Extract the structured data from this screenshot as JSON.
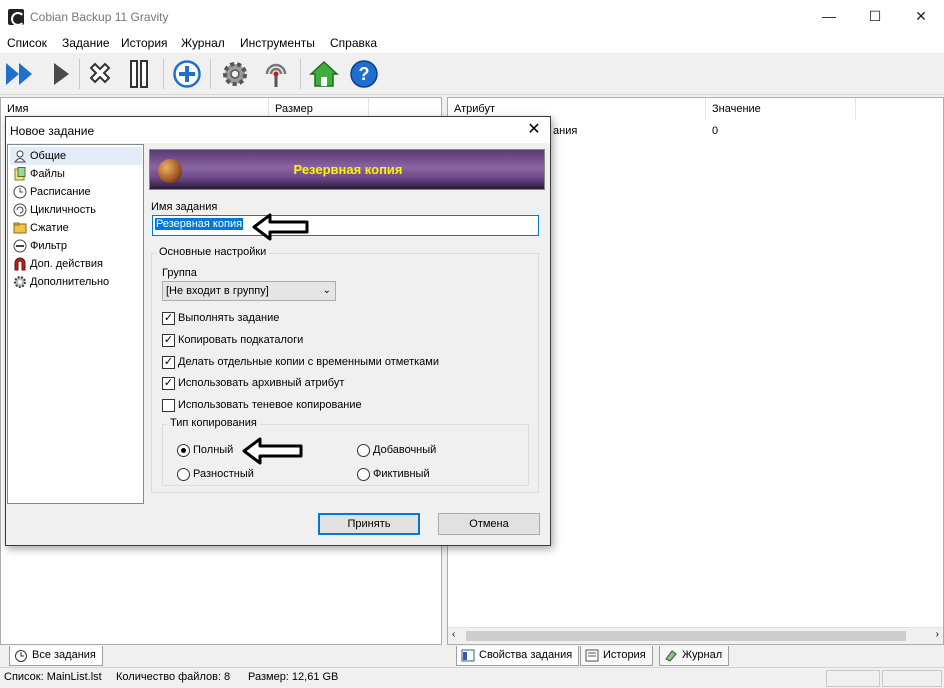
{
  "window": {
    "title": "Cobian Backup 11 Gravity",
    "minimize": "—",
    "maximize": "☐",
    "close": "✕"
  },
  "menu": [
    "Список",
    "Задание",
    "История",
    "Журнал",
    "Инструменты",
    "Справка"
  ],
  "toolbar": {
    "icons": [
      "run-all-icon",
      "run-icon",
      "cancel-icon",
      "pause-icon",
      "add-task-icon",
      "settings-icon",
      "signal-icon",
      "home-icon",
      "help-icon"
    ]
  },
  "left_pane": {
    "columns": [
      "Имя",
      "Размер"
    ]
  },
  "right_pane": {
    "columns": [
      "Атрибут",
      "Значение"
    ],
    "row_attribute_partial": "ания",
    "row_value": "0"
  },
  "bottom_tabs": {
    "left": [
      "Все задания"
    ],
    "right": [
      "Свойства задания",
      "История",
      "Журнал"
    ]
  },
  "status": {
    "list": "Список: MainList.lst",
    "files": "Количество файлов: 8",
    "size": "Размер: 12,61 GB"
  },
  "dialog": {
    "title": "Новое задание",
    "close": "✕",
    "nav": [
      "Общие",
      "Файлы",
      "Расписание",
      "Цикличность",
      "Сжатие",
      "Фильтр",
      "Доп. действия",
      "Дополнительно"
    ],
    "nav_selected": "Общие",
    "banner": "Резервная копия",
    "task_name_label": "Имя задания",
    "task_name_value": "Резервная копия",
    "basic_settings": "Основные настройки",
    "group_label": "Группа",
    "group_value": "[Не входит в группу]",
    "checkboxes": [
      {
        "label": "Выполнять задание",
        "checked": true
      },
      {
        "label": "Копировать подкаталоги",
        "checked": true
      },
      {
        "label": "Делать отдельные копии с временными отметками",
        "checked": true
      },
      {
        "label": "Использовать архивный атрибут",
        "checked": true
      },
      {
        "label": "Использовать теневое копирование",
        "checked": false
      }
    ],
    "copy_type_label": "Тип копирования",
    "copy_types": [
      {
        "label": "Полный",
        "selected": true
      },
      {
        "label": "Добавочный",
        "selected": false
      },
      {
        "label": "Разностный",
        "selected": false
      },
      {
        "label": "Фиктивный",
        "selected": false
      }
    ],
    "ok": "Принять",
    "cancel": "Отмена"
  }
}
